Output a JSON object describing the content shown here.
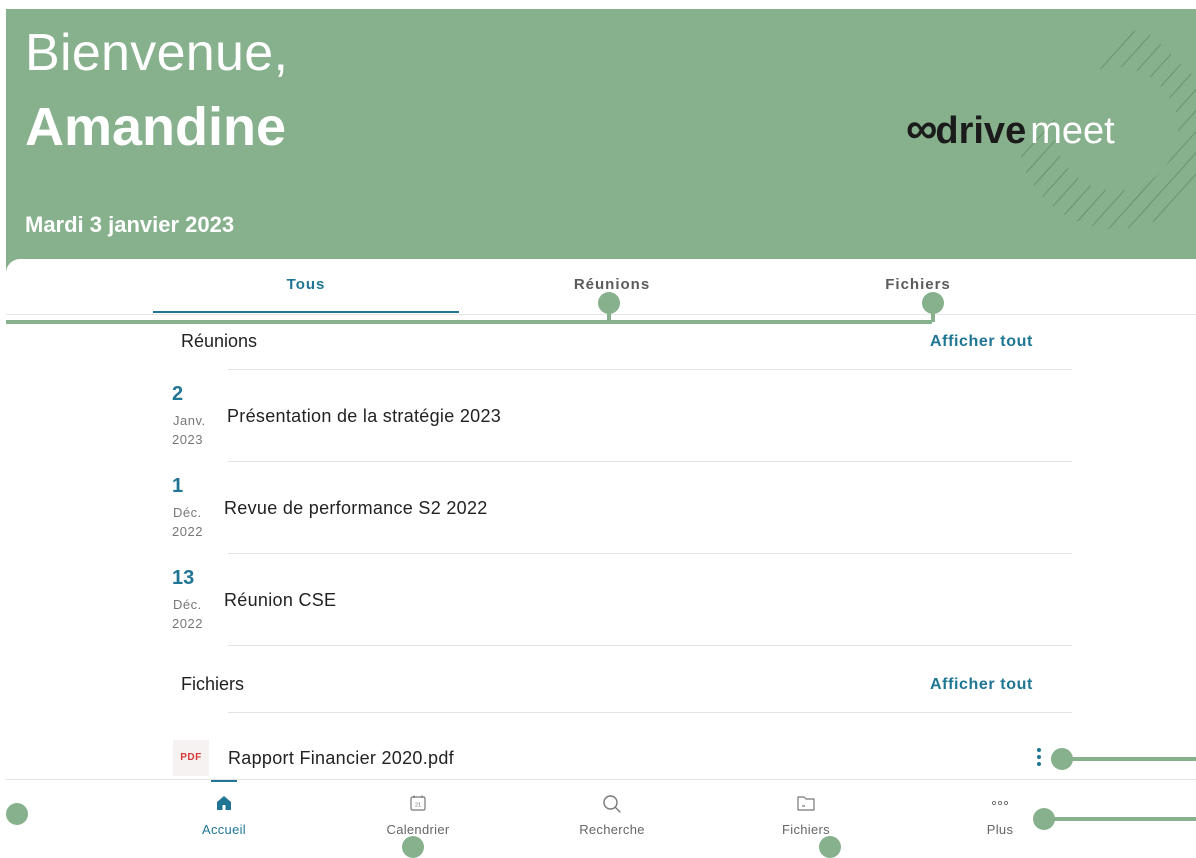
{
  "header": {
    "greeting": "Bienvenue,",
    "user_name": "Amandine",
    "date": "Mardi 3 janvier 2023",
    "logo": {
      "drive": "drive",
      "meet": "meet"
    },
    "bg_color": "#87b18d"
  },
  "tabs": [
    {
      "label": "Tous",
      "active": true
    },
    {
      "label": "Réunions",
      "active": false
    },
    {
      "label": "Fichiers",
      "active": false
    }
  ],
  "meetings": {
    "title": "Réunions",
    "show_all": "Afficher tout",
    "items": [
      {
        "day": "2",
        "month": "Janv.",
        "year": "2023",
        "title": "Présentation de la stratégie 2023"
      },
      {
        "day": "1",
        "month": "Déc.",
        "year": "2022",
        "title": "Revue de performance  S2 2022"
      },
      {
        "day": "13",
        "month": "Déc.",
        "year": "2022",
        "title": "Réunion CSE"
      }
    ]
  },
  "files": {
    "title": "Fichiers",
    "show_all": "Afficher tout",
    "items": [
      {
        "type": "PDF",
        "name": "Rapport Financier 2020.pdf"
      }
    ]
  },
  "bottom_nav": [
    {
      "label": "Accueil",
      "icon": "home-icon",
      "active": true
    },
    {
      "label": "Calendrier",
      "icon": "calendar-icon",
      "active": false
    },
    {
      "label": "Recherche",
      "icon": "search-icon",
      "active": false
    },
    {
      "label": "Fichiers",
      "icon": "folder-icon",
      "active": false
    },
    {
      "label": "Plus",
      "icon": "more-icon",
      "active": false
    }
  ],
  "accent_color": "#1f7694"
}
